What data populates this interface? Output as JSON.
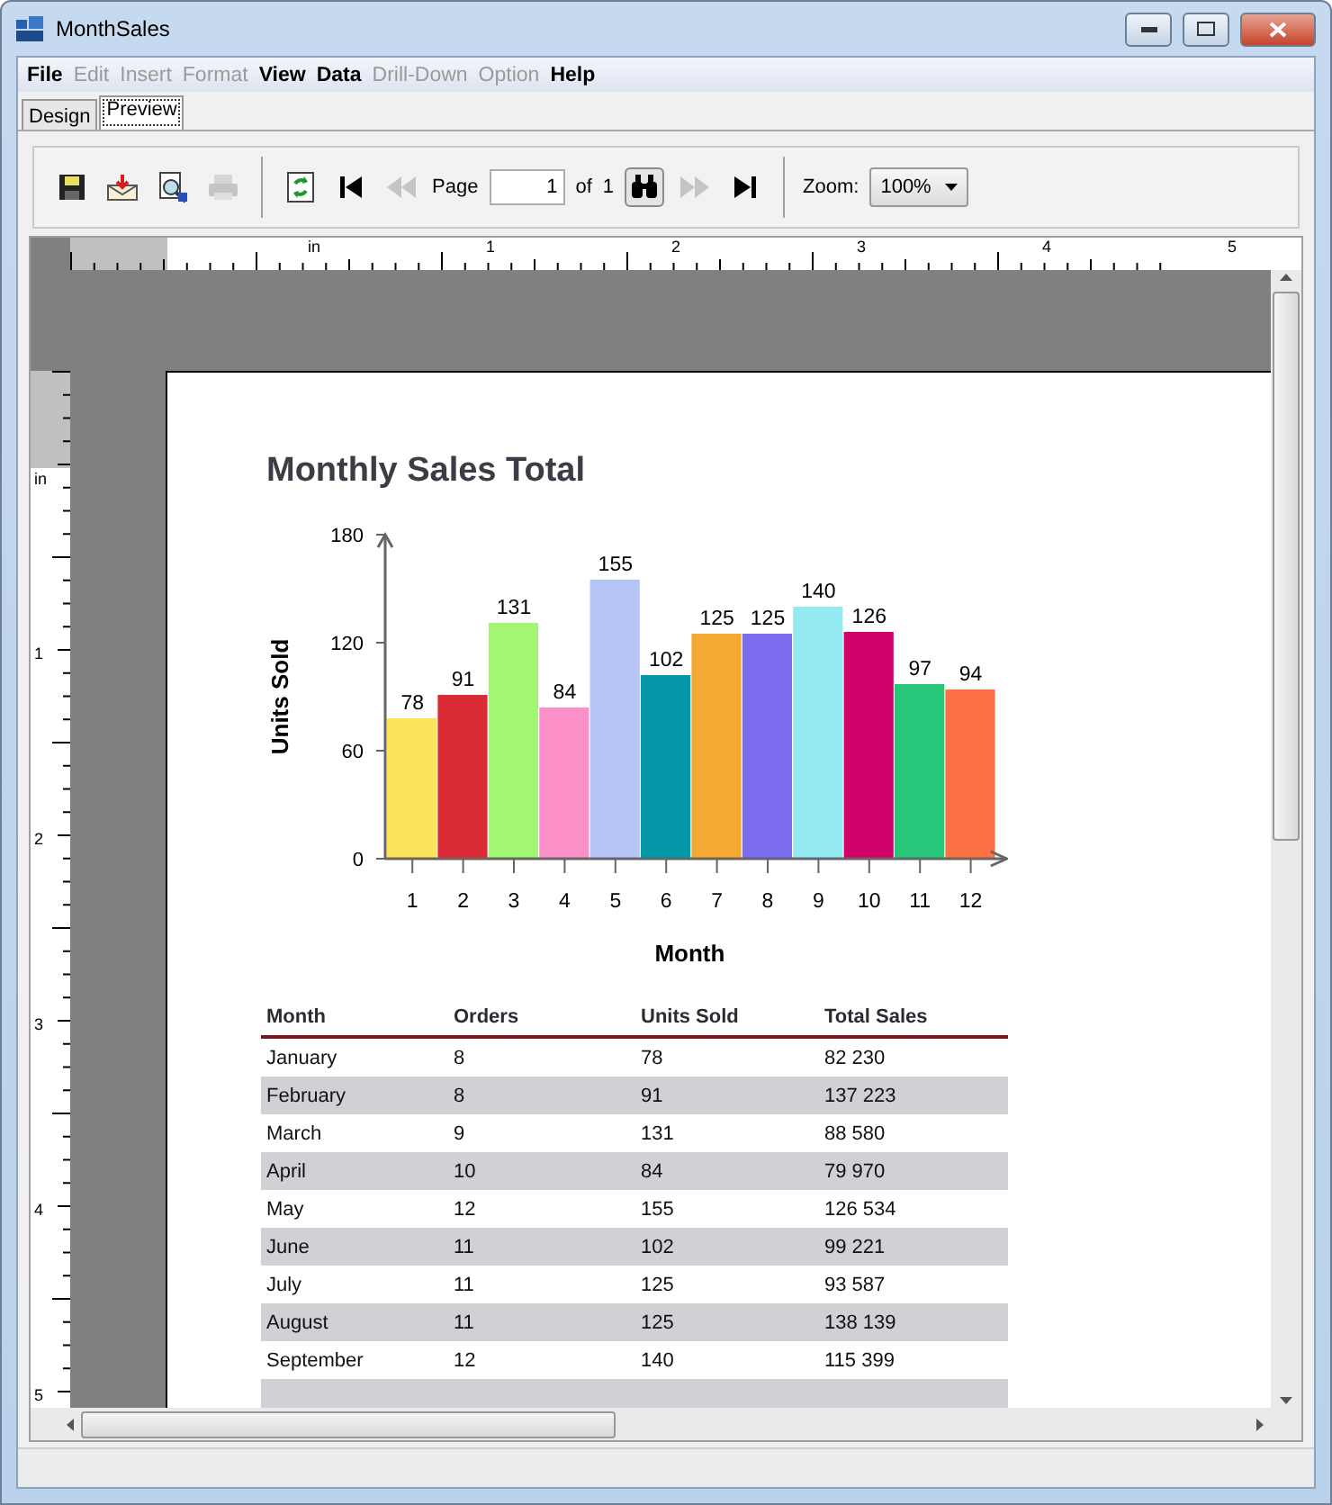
{
  "window": {
    "title": "MonthSales"
  },
  "menu": [
    {
      "label": "File",
      "disabled": false
    },
    {
      "label": "Edit",
      "disabled": true
    },
    {
      "label": "Insert",
      "disabled": true
    },
    {
      "label": "Format",
      "disabled": true
    },
    {
      "label": "View",
      "disabled": false
    },
    {
      "label": "Data",
      "disabled": false
    },
    {
      "label": "Drill-Down",
      "disabled": true
    },
    {
      "label": "Option",
      "disabled": true
    },
    {
      "label": "Help",
      "disabled": false
    }
  ],
  "tabs": [
    {
      "label": "Design",
      "selected": false
    },
    {
      "label": "Preview",
      "selected": true
    }
  ],
  "toolbar": {
    "file_buttons": [
      {
        "kind": "save",
        "disabled": false
      },
      {
        "kind": "email",
        "disabled": false
      },
      {
        "kind": "export",
        "disabled": false
      },
      {
        "kind": "print",
        "disabled": true
      }
    ],
    "nav_left": [
      {
        "kind": "refresh",
        "disabled": false
      },
      {
        "kind": "first",
        "disabled": false
      },
      {
        "kind": "prev",
        "disabled": true
      }
    ],
    "page_label": "Page",
    "page_value": "1",
    "of_label": "of",
    "page_count": "1",
    "nav_right": [
      {
        "kind": "find",
        "disabled": false
      },
      {
        "kind": "next",
        "disabled": true
      },
      {
        "kind": "last",
        "disabled": false
      }
    ],
    "zoom_label": "Zoom:",
    "zoom_value": "100%"
  },
  "rulers": {
    "top_unit": "in",
    "left_unit": "in",
    "top_marks": [
      "1",
      "2",
      "3",
      "4",
      "5"
    ],
    "left_marks": [
      "1",
      "2",
      "3",
      "4",
      "5"
    ]
  },
  "report": {
    "title": "Monthly Sales Total",
    "chart_data": {
      "type": "bar",
      "xlabel": "Month",
      "ylabel": "Units Sold",
      "categories": [
        "1",
        "2",
        "3",
        "4",
        "5",
        "6",
        "7",
        "8",
        "9",
        "10",
        "11",
        "12"
      ],
      "series": [
        {
          "color": "#fbe35e",
          "values": [
            78,
            null,
            null,
            null,
            null,
            null,
            null,
            null,
            null,
            null,
            null,
            null
          ]
        },
        {
          "color": "#d92b36",
          "values": [
            null,
            91,
            null,
            null,
            null,
            null,
            null,
            null,
            null,
            null,
            null,
            null
          ]
        },
        {
          "color": "#a3f574",
          "values": [
            null,
            null,
            131,
            null,
            null,
            null,
            null,
            null,
            null,
            null,
            null,
            null
          ]
        },
        {
          "color": "#fb91c8",
          "values": [
            null,
            null,
            null,
            84,
            null,
            null,
            null,
            null,
            null,
            null,
            null,
            null
          ]
        },
        {
          "color": "#b7c4f6",
          "values": [
            null,
            null,
            null,
            null,
            155,
            null,
            null,
            null,
            null,
            null,
            null,
            null
          ]
        },
        {
          "color": "#0397a8",
          "values": [
            null,
            null,
            null,
            null,
            null,
            102,
            null,
            null,
            null,
            null,
            null,
            null
          ]
        },
        {
          "color": "#f3a934",
          "values": [
            null,
            null,
            null,
            null,
            null,
            null,
            125,
            null,
            null,
            null,
            null,
            null
          ]
        },
        {
          "color": "#7b6ded",
          "values": [
            null,
            null,
            null,
            null,
            null,
            null,
            null,
            125,
            null,
            null,
            null,
            null
          ]
        },
        {
          "color": "#94e9f2",
          "values": [
            null,
            null,
            null,
            null,
            null,
            null,
            null,
            null,
            140,
            null,
            null,
            null
          ]
        },
        {
          "color": "#cf0269",
          "values": [
            null,
            null,
            null,
            null,
            null,
            null,
            null,
            null,
            null,
            126,
            null,
            null
          ]
        },
        {
          "color": "#27c678",
          "values": [
            null,
            null,
            null,
            null,
            null,
            null,
            null,
            null,
            null,
            null,
            97,
            null
          ]
        },
        {
          "color": "#fd7245",
          "values": [
            null,
            null,
            null,
            null,
            null,
            null,
            null,
            null,
            null,
            null,
            null,
            94
          ]
        }
      ],
      "ylim": [
        0,
        180
      ],
      "yticks": [
        0,
        60,
        120,
        180
      ],
      "data_labels": true
    },
    "table": {
      "columns": [
        "Month",
        "Orders",
        "Units Sold",
        "Total Sales"
      ],
      "rows": [
        [
          "January",
          "8",
          "78",
          "82 230"
        ],
        [
          "February",
          "8",
          "91",
          "137 223"
        ],
        [
          "March",
          "9",
          "131",
          "88 580"
        ],
        [
          "April",
          "10",
          "84",
          "79 970"
        ],
        [
          "May",
          "12",
          "155",
          "126 534"
        ],
        [
          "June",
          "11",
          "102",
          "99 221"
        ],
        [
          "July",
          "11",
          "125",
          "93 587"
        ],
        [
          "August",
          "11",
          "125",
          "138 139"
        ],
        [
          "September",
          "12",
          "140",
          "115 399"
        ]
      ]
    }
  }
}
